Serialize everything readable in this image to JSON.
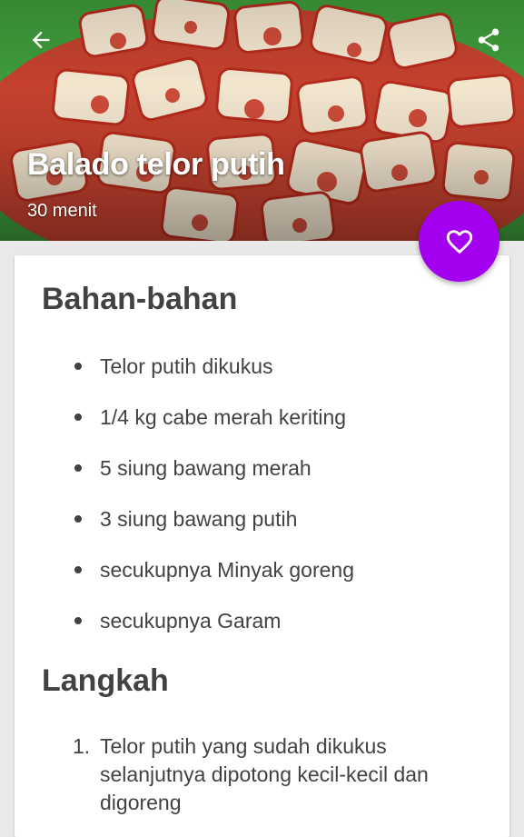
{
  "header": {
    "title": "Balado telor putih",
    "duration": "30 menit",
    "back_icon": "arrow-left-icon",
    "share_icon": "share-icon"
  },
  "favorite": {
    "icon": "heart-outline-icon",
    "color": "#a400f0"
  },
  "ingredients": {
    "title": "Bahan-bahan",
    "items": [
      "Telor putih dikukus",
      "1/4 kg cabe merah keriting",
      "5 siung bawang merah",
      "3 siung bawang putih",
      "secukupnya Minyak goreng",
      "secukupnya Garam"
    ]
  },
  "steps": {
    "title": "Langkah",
    "items": [
      {
        "number": "1.",
        "text": "Telor putih yang sudah dikukus selanjutnya dipotong kecil-kecil dan digoreng"
      }
    ]
  }
}
